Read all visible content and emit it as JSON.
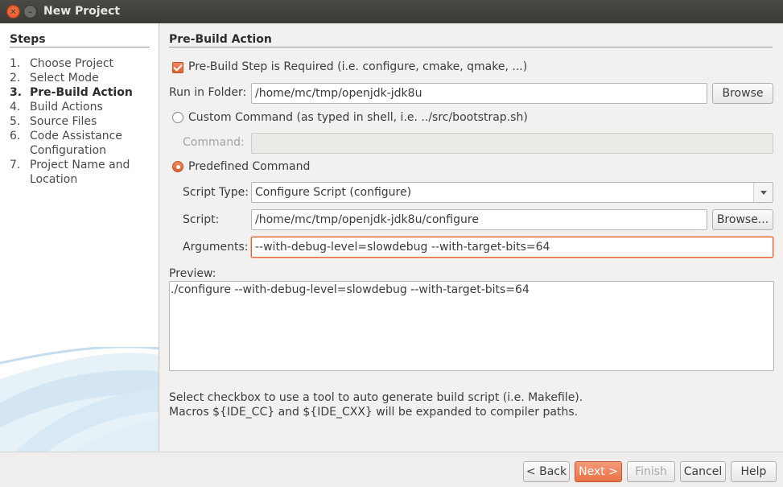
{
  "window": {
    "title": "New Project"
  },
  "sidebar": {
    "heading": "Steps",
    "steps": [
      {
        "num": "1.",
        "label": "Choose Project"
      },
      {
        "num": "2.",
        "label": "Select Mode"
      },
      {
        "num": "3.",
        "label": "Pre-Build Action",
        "current": true
      },
      {
        "num": "4.",
        "label": "Build Actions"
      },
      {
        "num": "5.",
        "label": "Source Files"
      },
      {
        "num": "6.",
        "label": "Code Assistance Configuration"
      },
      {
        "num": "7.",
        "label": "Project Name and Location"
      }
    ]
  },
  "main": {
    "section_title": "Pre-Build Action",
    "prebuild_required": {
      "label": "Pre-Build Step is Required (i.e. configure, cmake, qmake, ...)",
      "checked": true
    },
    "run_in_folder": {
      "label": "Run in Folder:",
      "value": "/home/mc/tmp/openjdk-jdk8u",
      "browse_label": "Browse"
    },
    "custom_command": {
      "label": "Custom Command (as typed in shell, i.e. ../src/bootstrap.sh)",
      "selected": false
    },
    "command": {
      "label": "Command:",
      "value": ""
    },
    "predefined_command": {
      "label": "Predefined Command",
      "selected": true
    },
    "script_type": {
      "label": "Script Type:",
      "value": "Configure Script (configure)"
    },
    "script": {
      "label": "Script:",
      "value": "/home/mc/tmp/openjdk-jdk8u/configure",
      "browse_label": "Browse..."
    },
    "arguments": {
      "label": "Arguments:",
      "value": "--with-debug-level=slowdebug --with-target-bits=64"
    },
    "preview": {
      "label": "Preview:",
      "text": "./configure --with-debug-level=slowdebug --with-target-bits=64"
    },
    "hint_line1": "Select checkbox to use a tool to auto generate build script (i.e. Makefile).",
    "hint_line2": "Macros ${IDE_CC} and ${IDE_CXX} will be expanded to compiler paths."
  },
  "footer": {
    "back": "< Back",
    "next": "Next >",
    "finish": "Finish",
    "cancel": "Cancel",
    "help": "Help"
  },
  "colors": {
    "accent": "#e9683a",
    "background": "#f2f1f0",
    "titlebar": "#3c3b37"
  }
}
